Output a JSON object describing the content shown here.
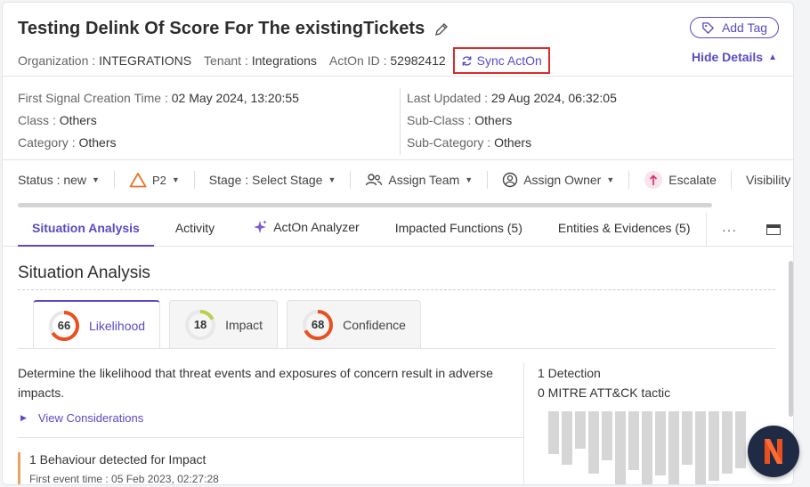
{
  "header": {
    "title": "Testing Delink Of Score For The existingTickets",
    "org_key": "Organization : ",
    "org_val": "INTEGRATIONS",
    "tenant_key": "Tenant : ",
    "tenant_val": "Integrations",
    "acton_key": "ActOn ID : ",
    "acton_val": "52982412",
    "sync_label": "Sync ActOn",
    "add_tag_label": "Add Tag",
    "hide_details_label": "Hide Details"
  },
  "details": {
    "first_signal_key": "First Signal Creation Time : ",
    "first_signal_val": "02 May 2024, 13:20:55",
    "class_key": "Class : ",
    "class_val": "Others",
    "category_key": "Category : ",
    "category_val": "Others",
    "last_updated_key": "Last Updated : ",
    "last_updated_val": "29 Aug 2024, 06:32:05",
    "subclass_key": "Sub-Class : ",
    "subclass_val": "Others",
    "subcategory_key": "Sub-Category : ",
    "subcategory_val": "Others"
  },
  "actions": {
    "status": "Status : new",
    "priority": "P2",
    "stage": "Stage : Select Stage",
    "assign_team": "Assign Team",
    "assign_owner": "Assign Owner",
    "escalate": "Escalate",
    "visibility": "Visibility"
  },
  "tabs": [
    {
      "label": "Situation Analysis"
    },
    {
      "label": "Activity"
    },
    {
      "label": "ActOn Analyzer"
    },
    {
      "label": "Impacted Functions (5)"
    },
    {
      "label": "Entities & Evidences (5)"
    }
  ],
  "tabs_more": "···",
  "situation": {
    "title": "Situation Analysis",
    "scores": [
      {
        "label": "Likelihood",
        "value": "66",
        "percent": 66,
        "color": "#e8501f"
      },
      {
        "label": "Impact",
        "value": "18",
        "percent": 18,
        "color": "#b8d04a"
      },
      {
        "label": "Confidence",
        "value": "68",
        "percent": 68,
        "color": "#e8501f"
      }
    ],
    "description": "Determine the likelihood that threat events and exposures of concern result in adverse impacts.",
    "view_considerations": "View Considerations",
    "behaviour_title": "1 Behaviour detected for Impact",
    "first_event": "First event time : 05 Feb 2023, 02:27:28",
    "detection": "1 Detection",
    "mitre": "0 MITRE ATT&CK tactic"
  },
  "colors": {
    "accent": "#5a4bc5",
    "highlight_border": "#d92b2b",
    "fab_bg": "#1f2a44",
    "fab_logo": "#e8501f"
  }
}
